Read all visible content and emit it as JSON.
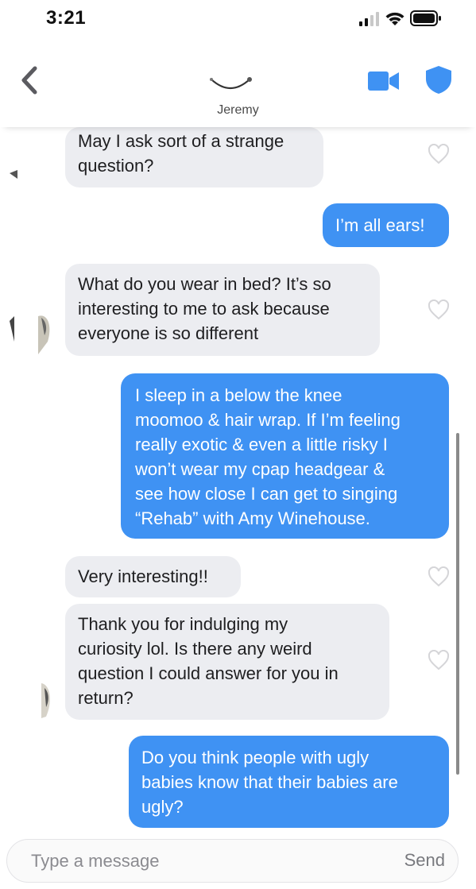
{
  "status_bar": {
    "time": "3:21"
  },
  "header": {
    "match_name": "Jeremy"
  },
  "messages": [
    {
      "side": "in",
      "lines": [
        "May I ask sort of a strange",
        "question?"
      ]
    },
    {
      "side": "out",
      "lines": [
        "I’m all ears!"
      ]
    },
    {
      "side": "in",
      "lines": [
        "What do you wear in bed? It’s so",
        "interesting to me to ask because",
        "everyone is so different"
      ]
    },
    {
      "side": "out",
      "lines": [
        "I sleep in a below the knee",
        "moomoo & hair wrap. If I’m feeling",
        "really exotic & even a little risky I",
        "won’t wear my cpap headgear &",
        "see how close I can get to singing",
        "“Rehab” with Amy Winehouse."
      ]
    },
    {
      "side": "in",
      "lines": [
        "Very interesting!!"
      ]
    },
    {
      "side": "in",
      "lines": [
        "Thank you for indulging my",
        "curiosity lol. Is there any weird",
        "question I could answer for you in",
        "return?"
      ]
    },
    {
      "side": "out",
      "lines": [
        "Do you think people with ugly",
        "babies know that their babies are",
        "ugly?"
      ]
    }
  ],
  "composer": {
    "placeholder": "Type a message",
    "send_label": "Send"
  },
  "colors": {
    "accent": "#3f92f3",
    "incoming_bubble": "#ecedf1"
  }
}
